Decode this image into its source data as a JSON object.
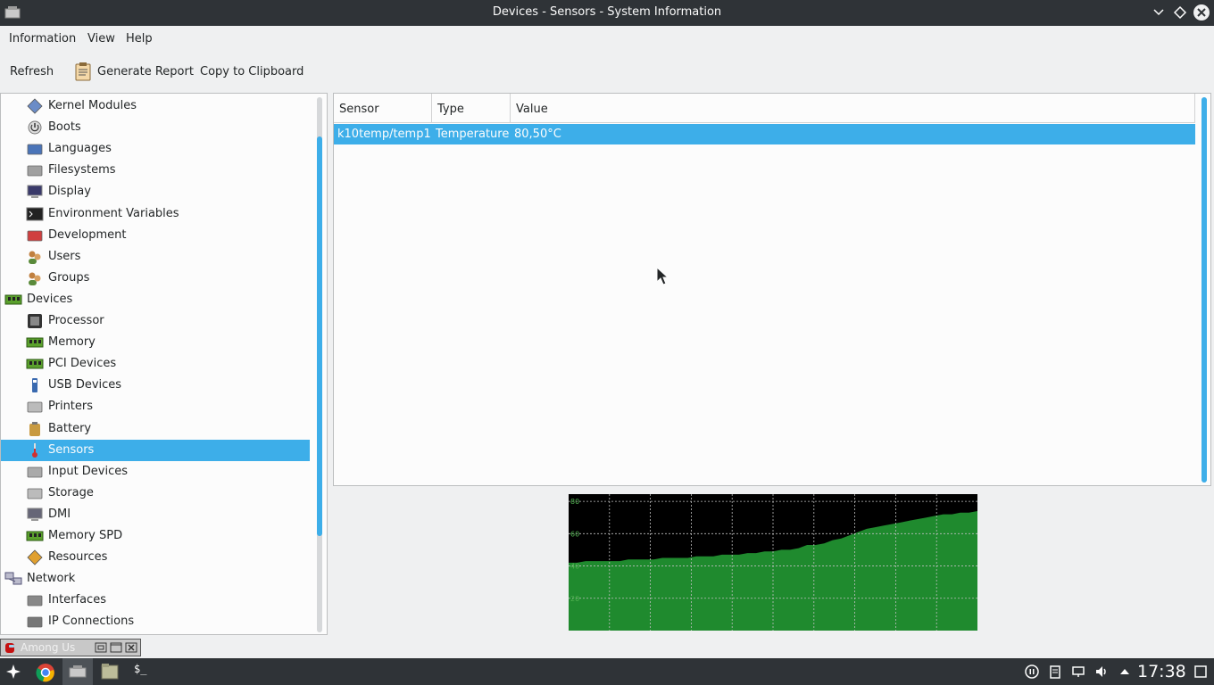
{
  "window": {
    "title": "Devices - Sensors - System Information"
  },
  "menu": {
    "information": "Information",
    "view": "View",
    "help": "Help"
  },
  "toolbar": {
    "refresh": "Refresh",
    "generate_report": "Generate Report",
    "copy_clipboard": "Copy to Clipboard"
  },
  "sidebar": {
    "items": [
      {
        "label": "Kernel Modules",
        "icon": "kernel-modules-icon",
        "level": 1
      },
      {
        "label": "Boots",
        "icon": "power-icon",
        "level": 1
      },
      {
        "label": "Languages",
        "icon": "languages-icon",
        "level": 1
      },
      {
        "label": "Filesystems",
        "icon": "filesystems-icon",
        "level": 1
      },
      {
        "label": "Display",
        "icon": "display-icon",
        "level": 1
      },
      {
        "label": "Environment Variables",
        "icon": "terminal-icon",
        "level": 1
      },
      {
        "label": "Development",
        "icon": "development-icon",
        "level": 1
      },
      {
        "label": "Users",
        "icon": "users-icon",
        "level": 1
      },
      {
        "label": "Groups",
        "icon": "groups-icon",
        "level": 1
      },
      {
        "label": "Devices",
        "icon": "devices-icon",
        "level": 0
      },
      {
        "label": "Processor",
        "icon": "processor-icon",
        "level": 1
      },
      {
        "label": "Memory",
        "icon": "memory-icon",
        "level": 1
      },
      {
        "label": "PCI Devices",
        "icon": "pci-icon",
        "level": 1
      },
      {
        "label": "USB Devices",
        "icon": "usb-icon",
        "level": 1
      },
      {
        "label": "Printers",
        "icon": "printer-icon",
        "level": 1
      },
      {
        "label": "Battery",
        "icon": "battery-icon",
        "level": 1
      },
      {
        "label": "Sensors",
        "icon": "thermometer-icon",
        "level": 1
      },
      {
        "label": "Input Devices",
        "icon": "input-devices-icon",
        "level": 1
      },
      {
        "label": "Storage",
        "icon": "storage-icon",
        "level": 1
      },
      {
        "label": "DMI",
        "icon": "dmi-icon",
        "level": 1
      },
      {
        "label": "Memory SPD",
        "icon": "memory-spd-icon",
        "level": 1
      },
      {
        "label": "Resources",
        "icon": "resources-icon",
        "level": 1
      },
      {
        "label": "Network",
        "icon": "network-icon",
        "level": 0
      },
      {
        "label": "Interfaces",
        "icon": "interfaces-icon",
        "level": 1
      },
      {
        "label": "IP Connections",
        "icon": "ip-connections-icon",
        "level": 1
      }
    ],
    "selected": "Sensors"
  },
  "table": {
    "columns": [
      "Sensor",
      "Type",
      "Value"
    ],
    "rows": [
      {
        "sensor": "k10temp/temp1",
        "type": "Temperature",
        "value": "80,50°C"
      }
    ]
  },
  "graph": {
    "tick_labels": [
      "80",
      "60",
      "40",
      "20"
    ],
    "colors": {
      "background": "#000000",
      "fill": "#1f8a2e",
      "grid": "#bfbfbf"
    },
    "values": [
      42,
      42,
      43,
      43,
      43,
      43,
      43,
      44,
      44,
      44,
      44,
      45,
      45,
      45,
      45,
      46,
      46,
      46,
      47,
      47,
      47,
      48,
      48,
      49,
      49,
      50,
      50,
      51,
      53,
      53,
      54,
      56,
      57,
      59,
      61,
      63,
      64,
      65,
      66,
      67,
      68,
      69,
      70,
      71,
      72,
      72,
      73,
      73,
      74
    ]
  },
  "minimized_window": {
    "label": "Among Us"
  },
  "taskbar": {
    "clock": "17:38",
    "terminal_label": "$_",
    "colors": {
      "background": "#2f3337"
    }
  }
}
